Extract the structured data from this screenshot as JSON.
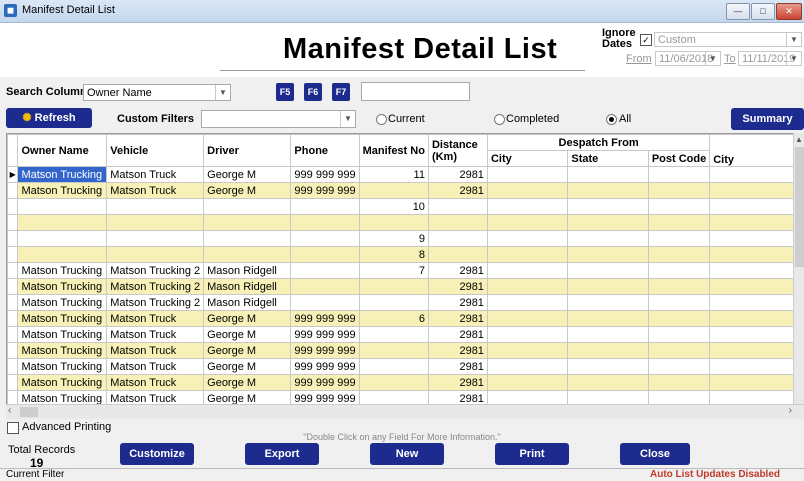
{
  "window": {
    "title": "Manifest Detail List",
    "min": "—",
    "max": "□",
    "close": "✕"
  },
  "header": {
    "title": "Manifest Detail List",
    "ignore_dates_line1": "Ignore",
    "ignore_dates_line2": "Dates",
    "ignore_checked": "✓",
    "date_range": "Custom",
    "from_label": "From",
    "from_value": "11/06/2018",
    "to_label": "To",
    "to_value": "11/11/2019"
  },
  "search": {
    "label": "Search Column",
    "column": "Owner Name",
    "f5": "F5",
    "f6": "F6",
    "f7": "F7",
    "value": ""
  },
  "filters": {
    "refresh": "Refresh",
    "custom_filters_label": "Custom Filters",
    "custom_filter_value": "",
    "radio_current": "Current",
    "radio_completed": "Completed",
    "radio_all": "All",
    "selected": "All",
    "summary": "Summary"
  },
  "grid": {
    "group_header": "Despatch From",
    "columns": [
      "Owner Name",
      "Vehicle",
      "Driver",
      "Phone",
      "Manifest No",
      "Distance (Km)",
      "City",
      "State",
      "Post Code",
      "City"
    ],
    "rows": [
      [
        "Matson Trucking",
        "Matson Truck",
        "George M",
        "999 999 999",
        "11",
        "2981",
        "",
        "",
        "",
        ""
      ],
      [
        "Matson Trucking",
        "Matson Truck",
        "George M",
        "999 999 999",
        "",
        "2981",
        "",
        "",
        "",
        ""
      ],
      [
        "",
        "",
        "",
        "",
        "10",
        "",
        "",
        "",
        "",
        ""
      ],
      [
        "",
        "",
        "",
        "",
        "",
        "",
        "",
        "",
        "",
        ""
      ],
      [
        "",
        "",
        "",
        "",
        "9",
        "",
        "",
        "",
        "",
        ""
      ],
      [
        "",
        "",
        "",
        "",
        "8",
        "",
        "",
        "",
        "",
        ""
      ],
      [
        "Matson Trucking",
        "Matson Trucking 2",
        "Mason Ridgell",
        "",
        "7",
        "2981",
        "",
        "",
        "",
        ""
      ],
      [
        "Matson Trucking",
        "Matson Trucking 2",
        "Mason Ridgell",
        "",
        "",
        "2981",
        "",
        "",
        "",
        ""
      ],
      [
        "Matson Trucking",
        "Matson Trucking 2",
        "Mason Ridgell",
        "",
        "",
        "2981",
        "",
        "",
        "",
        ""
      ],
      [
        "Matson Trucking",
        "Matson Truck",
        "George M",
        "999 999 999",
        "6",
        "2981",
        "",
        "",
        "",
        ""
      ],
      [
        "Matson Trucking",
        "Matson Truck",
        "George M",
        "999 999 999",
        "",
        "2981",
        "",
        "",
        "",
        ""
      ],
      [
        "Matson Trucking",
        "Matson Truck",
        "George M",
        "999 999 999",
        "",
        "2981",
        "",
        "",
        "",
        ""
      ],
      [
        "Matson Trucking",
        "Matson Truck",
        "George M",
        "999 999 999",
        "",
        "2981",
        "",
        "",
        "",
        ""
      ],
      [
        "Matson Trucking",
        "Matson Truck",
        "George M",
        "999 999 999",
        "",
        "2981",
        "",
        "",
        "",
        ""
      ],
      [
        "Matson Trucking",
        "Matson Truck",
        "George M",
        "999 999 999",
        "",
        "2981",
        "",
        "",
        "",
        ""
      ],
      [
        "Matson Trucking",
        "Matson Truck",
        "George M",
        "999 999 999",
        "",
        "2981",
        "",
        "",
        "",
        ""
      ]
    ]
  },
  "footer": {
    "advanced_printing": "Advanced Printing",
    "hint": "\"Double Click on any Field For More Information.\"",
    "total_records_label": "Total Records",
    "total_records_value": "19",
    "customize": "Customize",
    "export": "Export",
    "new": "New",
    "print": "Print",
    "close": "Close",
    "current_filter": "Current Filter",
    "auto_updates": "Auto List Updates Disabled"
  },
  "colors": {
    "navy": "#1d2b8f",
    "row_highlight": "#f7f0b7",
    "selection": "#3366cc",
    "warning": "#c0392b"
  }
}
